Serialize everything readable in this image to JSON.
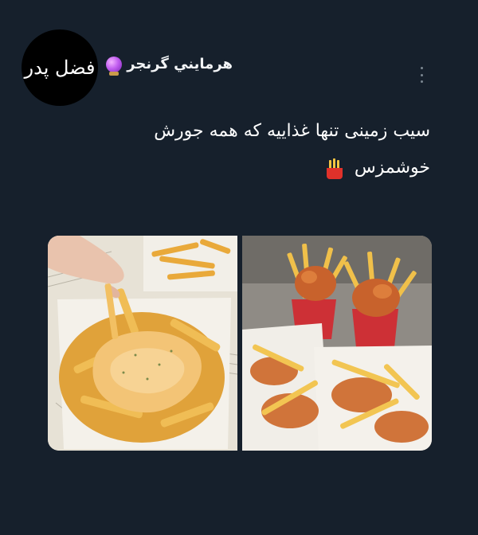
{
  "avatar": {
    "text": "فضل پدر"
  },
  "author": {
    "name": "هرمایني گرنجر",
    "badge_icon": "crystal-ball-icon"
  },
  "more_icon": "more-vertical-icon",
  "tweet": {
    "line1": "سیب زمینی تنها غذاییه که همه جورش",
    "line2": "خوشمزس",
    "emoji": "fries-icon"
  },
  "media": {
    "images": [
      {
        "name": "cheese-fries-photo"
      },
      {
        "name": "chicken-fries-photo"
      }
    ]
  },
  "colors": {
    "background": "#16202c",
    "text": "#ffffff",
    "muted": "#7b8792"
  }
}
